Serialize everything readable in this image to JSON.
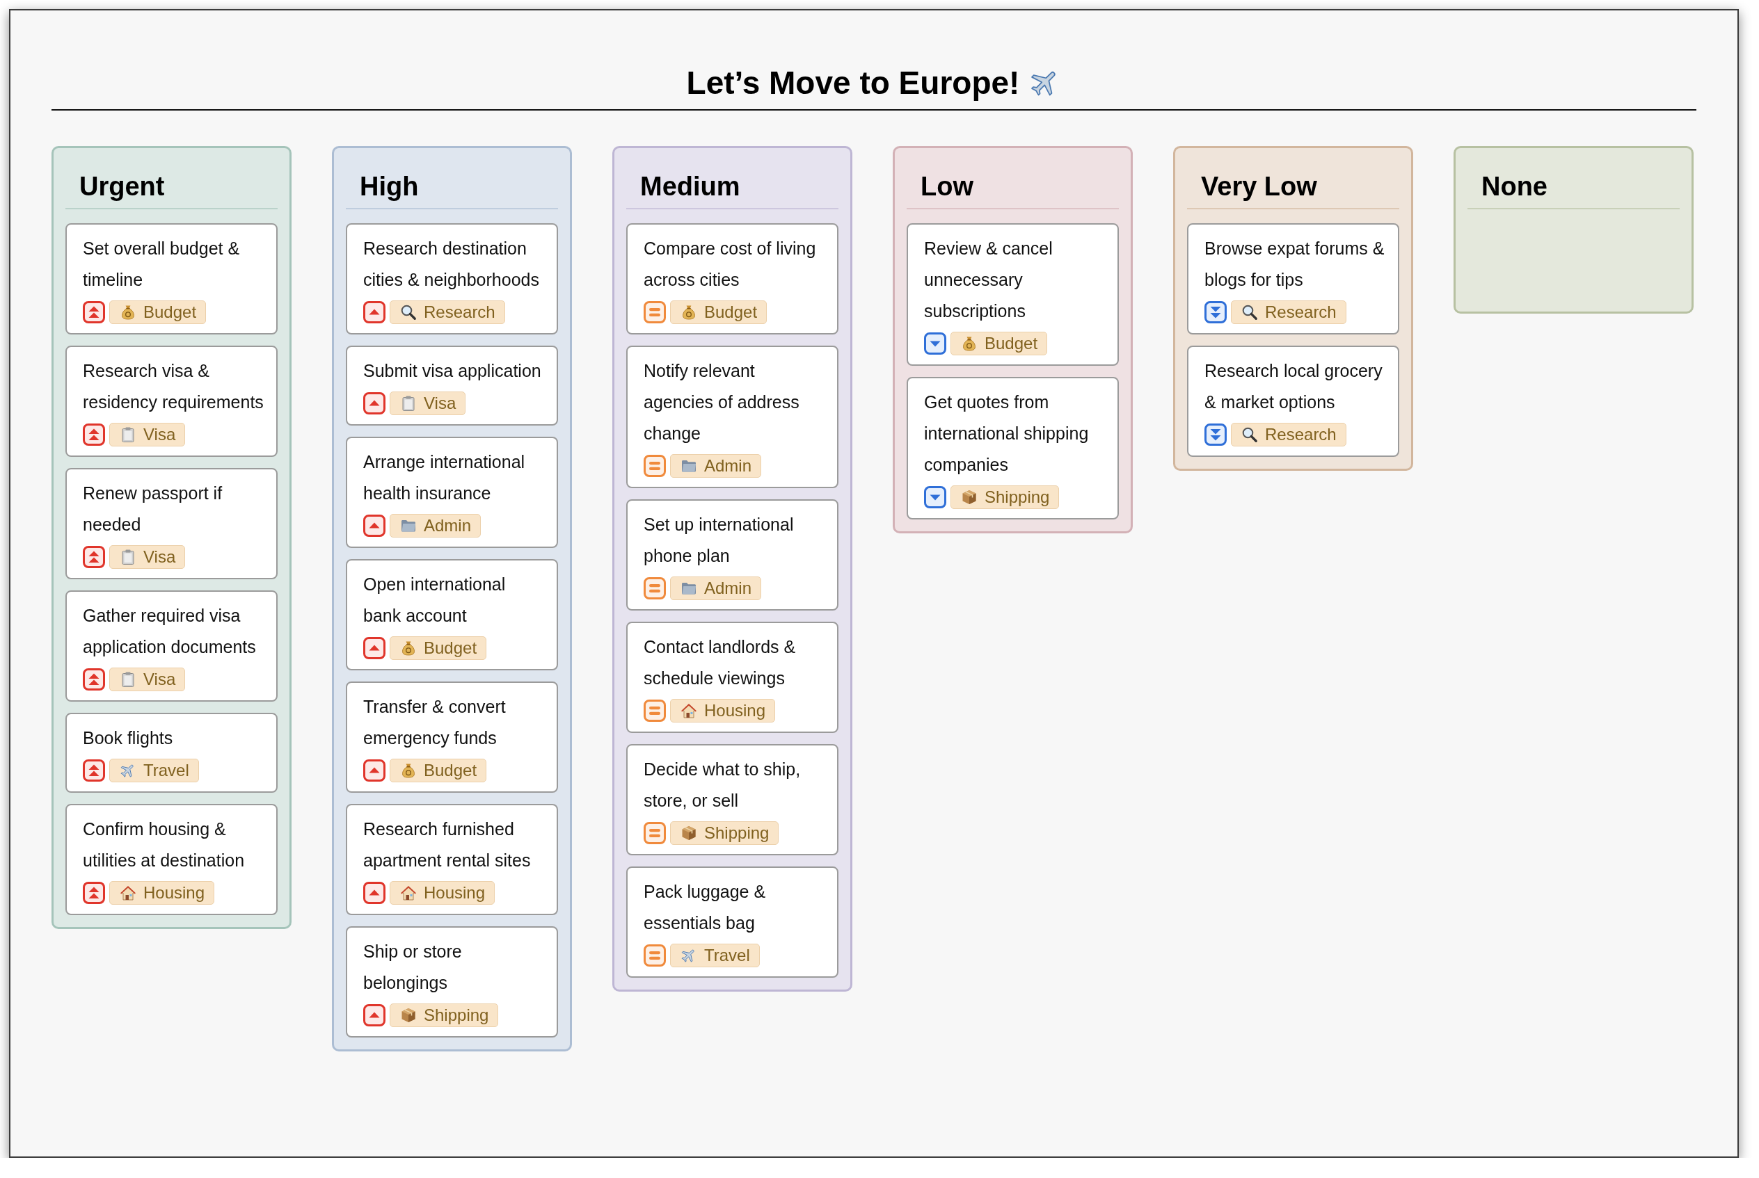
{
  "title": "Let’s Move to Europe!",
  "columns": [
    {
      "title": "Urgent",
      "kind": "urgent",
      "color": "#dde9e5",
      "cards": [
        {
          "text": "Set overall budget & timeline",
          "tag": {
            "label": "Budget",
            "kind": "budget"
          }
        },
        {
          "text": "Research visa & residency requirements",
          "tag": {
            "label": "Visa",
            "kind": "visa"
          }
        },
        {
          "text": "Renew passport if needed",
          "tag": {
            "label": "Visa",
            "kind": "visa"
          }
        },
        {
          "text": "Gather required visa application documents",
          "tag": {
            "label": "Visa",
            "kind": "visa"
          }
        },
        {
          "text": "Book flights",
          "tag": {
            "label": "Travel",
            "kind": "travel"
          }
        },
        {
          "text": "Confirm housing & utilities at destination",
          "tag": {
            "label": "Housing",
            "kind": "housing"
          }
        }
      ]
    },
    {
      "title": "High",
      "kind": "high",
      "color": "#dfe6ef",
      "cards": [
        {
          "text": "Research destination cities & neighborhoods",
          "tag": {
            "label": "Research",
            "kind": "research"
          }
        },
        {
          "text": "Submit visa application",
          "tag": {
            "label": "Visa",
            "kind": "visa"
          }
        },
        {
          "text": "Arrange international health insurance",
          "tag": {
            "label": "Admin",
            "kind": "admin"
          }
        },
        {
          "text": "Open international bank account",
          "tag": {
            "label": "Budget",
            "kind": "budget"
          }
        },
        {
          "text": "Transfer & convert emergency funds",
          "tag": {
            "label": "Budget",
            "kind": "budget"
          }
        },
        {
          "text": "Research furnished apartment rental sites",
          "tag": {
            "label": "Housing",
            "kind": "housing"
          }
        },
        {
          "text": "Ship or store belongings",
          "tag": {
            "label": "Shipping",
            "kind": "shipping"
          }
        }
      ]
    },
    {
      "title": "Medium",
      "kind": "medium",
      "color": "#e6e3ef",
      "cards": [
        {
          "text": "Compare cost of living across cities",
          "tag": {
            "label": "Budget",
            "kind": "budget"
          }
        },
        {
          "text": "Notify relevant agencies of address change",
          "tag": {
            "label": "Admin",
            "kind": "admin"
          }
        },
        {
          "text": "Set up international phone plan",
          "tag": {
            "label": "Admin",
            "kind": "admin"
          }
        },
        {
          "text": "Contact landlords & schedule viewings",
          "tag": {
            "label": "Housing",
            "kind": "housing"
          }
        },
        {
          "text": "Decide what to ship, store, or sell",
          "tag": {
            "label": "Shipping",
            "kind": "shipping"
          }
        },
        {
          "text": "Pack luggage & essentials bag",
          "tag": {
            "label": "Travel",
            "kind": "travel"
          }
        }
      ]
    },
    {
      "title": "Low",
      "kind": "low",
      "color": "#efe1e3",
      "cards": [
        {
          "text": "Review & cancel unnecessary subscriptions",
          "tag": {
            "label": "Budget",
            "kind": "budget"
          }
        },
        {
          "text": "Get quotes from international shipping companies",
          "tag": {
            "label": "Shipping",
            "kind": "shipping"
          }
        }
      ]
    },
    {
      "title": "Very Low",
      "kind": "very_low",
      "color": "#efe4da",
      "cards": [
        {
          "text": "Browse expat forums & blogs for tips",
          "tag": {
            "label": "Research",
            "kind": "research"
          }
        },
        {
          "text": "Research local grocery & market options",
          "tag": {
            "label": "Research",
            "kind": "research"
          }
        }
      ]
    },
    {
      "title": "None",
      "color": "#e4e8dc"
    }
  ]
}
